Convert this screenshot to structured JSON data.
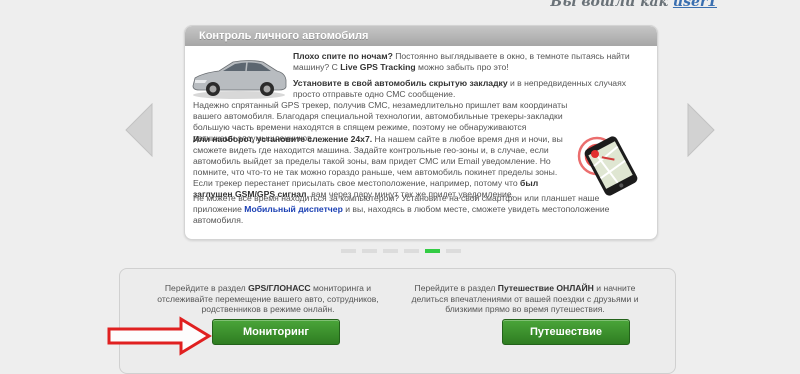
{
  "header": {
    "login_prefix": "Вы вошли как ",
    "username": "user1"
  },
  "slider": {
    "title": "Контроль личного автомобиля",
    "p1_bold": "Плохо спите по ночам?",
    "p1_rest": " Постоянно выглядываете в окно, в темноте пытаясь найти машину? С ",
    "p1_bold2": "Live GPS Tracking",
    "p1_end": " можно забыть про это!",
    "p2_bold": "Установите в свой автомобиль скрытую закладку",
    "p2_rest": " и в непредвиденных случаях просто отправьте одно СМС сообщение.",
    "p3": "Надежно спрятанный GPS трекер, получив СМС, незамедлительно пришлет вам координаты вашего автомобиля. Благодаря специальной технологии, автомобильные трекеры-закладки большую часть времени находятся в спящем режиме, поэтому не обнаруживаются датчиками злоумышленников.",
    "p4_bold": "Или наоборот, установите слежение 24x7.",
    "p4_rest": " На нашем сайте в любое время дня и ночи, вы сможете видеть где находится машина. Задайте контрольные гео-зоны и, в случае, если автомобиль выйдет за пределы такой зоны, вам придет СМС или Email уведомление. Но помните, что что-то не так можно гораздо раньше, чем автомобиль покинет пределы зоны. Если трекер перестанет присылать свое местоположение, например, потому что ",
    "p4_bold2": "был заглушен GSM/GPS сигнал",
    "p4_end": ", вам через пару минут так же придет уведомление.",
    "p5_start": "Не можете все время находиться за компьютером? Установите на свой смартфон или планшет наше приложение ",
    "p5_link": "Мобильный диспетчер",
    "p5_end": " и вы, находясь в любом месте, сможете увидеть местоположение автомобиля."
  },
  "pager": {
    "total": 6,
    "active_index": 4
  },
  "sections": {
    "monitoring": {
      "text_start": "Перейдите в раздел ",
      "text_bold": "GPS/ГЛОНАСС",
      "text_end": " мониторинга и отслеживайте перемещение вашего авто, сотрудников, родственников в режиме онлайн.",
      "button": "Мониторинг"
    },
    "travel": {
      "text_start": "Перейдите в раздел ",
      "text_bold": "Путешествие ОНЛАЙН",
      "text_end": " и начните делиться впечатлениями от вашей поездки с друзьями и близкими прямо во время путешествия.",
      "button": "Путешествие"
    }
  },
  "colors": {
    "accent_green": "#33cc44",
    "button_green": "#3a8f2c",
    "arrow_red": "#e02020",
    "link_blue": "#1a3fb3"
  },
  "icons": [
    "arrow-left-icon",
    "arrow-right-icon",
    "car-image",
    "smartphone-map-icon",
    "red-pointer-arrow"
  ]
}
